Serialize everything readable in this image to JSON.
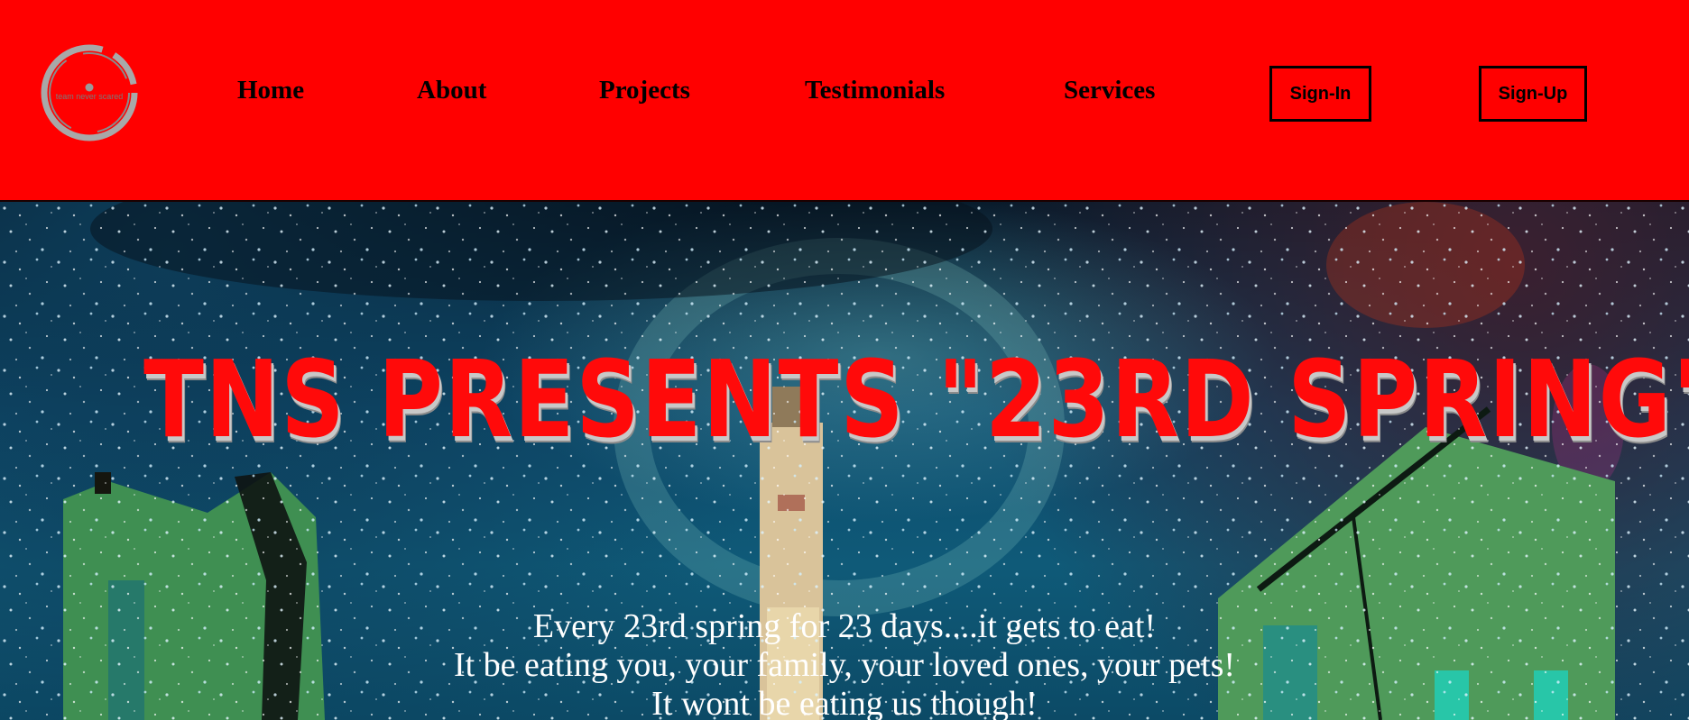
{
  "logo": {
    "icon": "ring-logo-icon",
    "text": "team never scared"
  },
  "nav": {
    "items": [
      {
        "label": "Home"
      },
      {
        "label": "About"
      },
      {
        "label": "Projects"
      },
      {
        "label": "Testimonials"
      },
      {
        "label": "Services"
      }
    ],
    "sign_in": "Sign-In",
    "sign_up": "Sign-Up"
  },
  "hero": {
    "title": "TNS PRESENTS \"23RD SPRING\"",
    "lines": [
      "Every 23rd spring for 23 days....it gets to eat!",
      "It be eating you, your family, your loved ones, your pets!",
      "It wont be eating us though!"
    ]
  },
  "colors": {
    "header_bg": "#ff0000",
    "title_red": "#ff0a0a",
    "hero_text": "#ffffff"
  }
}
